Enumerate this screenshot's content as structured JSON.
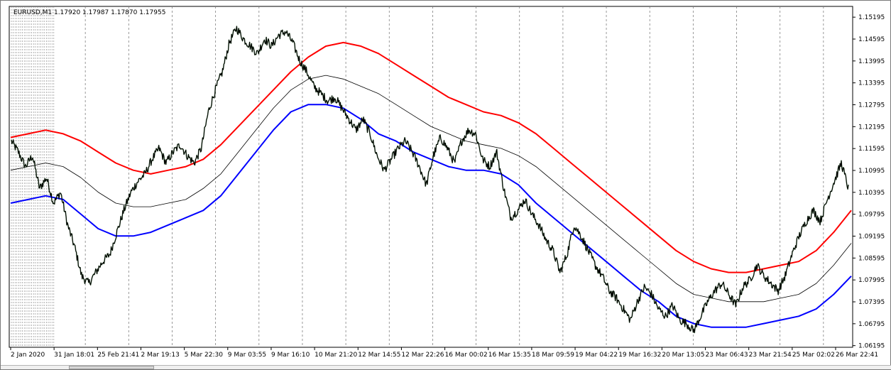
{
  "chart_data": {
    "type": "line",
    "title": "EURUSD,M1 1.17920 1.17987 1.17870 1.17955",
    "symbol": "EURUSD,M1",
    "ohlc": [
      "1.17920",
      "1.17987",
      "1.17870",
      "1.17955"
    ],
    "ylim": [
      1.0615,
      1.1549
    ],
    "y_ticks": [
      "1.15195",
      "1.14595",
      "1.13995",
      "1.13395",
      "1.12795",
      "1.12195",
      "1.11595",
      "1.10995",
      "1.10395",
      "1.09795",
      "1.09195",
      "1.08595",
      "1.07995",
      "1.07395",
      "1.06795",
      "1.06195"
    ],
    "x_ticks": [
      "2 Jan 2020",
      "31 Jan 18:01",
      "25 Feb 21:41",
      "2 Mar 19:13",
      "5 Mar 22:30",
      "9 Mar 03:55",
      "9 Mar 16:10",
      "10 Mar 21:20",
      "12 Mar 14:55",
      "12 Mar 22:26",
      "16 Mar 00:02",
      "16 Mar 15:35",
      "18 Mar 09:59",
      "19 Mar 04:22",
      "19 Mar 16:32",
      "20 Mar 13:05",
      "23 Mar 06:43",
      "23 Mar 21:54",
      "25 Mar 02:02",
      "26 Mar 22:41"
    ],
    "grid": true,
    "legend": "none",
    "series": [
      {
        "color": "#000000",
        "style": "price",
        "values": [
          1.118,
          1.115,
          1.111,
          1.114,
          1.105,
          1.108,
          1.101,
          1.104,
          1.095,
          1.089,
          1.081,
          1.079,
          1.082,
          1.085,
          1.087,
          1.093,
          1.099,
          1.104,
          1.107,
          1.109,
          1.113,
          1.116,
          1.112,
          1.115,
          1.117,
          1.114,
          1.112,
          1.116,
          1.126,
          1.132,
          1.137,
          1.145,
          1.149,
          1.146,
          1.144,
          1.142,
          1.146,
          1.144,
          1.147,
          1.148,
          1.145,
          1.14,
          1.137,
          1.133,
          1.131,
          1.129,
          1.13,
          1.127,
          1.124,
          1.121,
          1.124,
          1.12,
          1.114,
          1.11,
          1.113,
          1.116,
          1.118,
          1.115,
          1.111,
          1.106,
          1.114,
          1.119,
          1.116,
          1.112,
          1.118,
          1.121,
          1.12,
          1.113,
          1.111,
          1.115,
          1.105,
          1.097,
          1.099,
          1.102,
          1.098,
          1.095,
          1.091,
          1.088,
          1.082,
          1.087,
          1.095,
          1.092,
          1.088,
          1.084,
          1.081,
          1.077,
          1.075,
          1.072,
          1.069,
          1.074,
          1.078,
          1.076,
          1.072,
          1.07,
          1.073,
          1.069,
          1.068,
          1.066,
          1.07,
          1.074,
          1.077,
          1.079,
          1.076,
          1.073,
          1.078,
          1.08,
          1.084,
          1.081,
          1.079,
          1.077,
          1.081,
          1.087,
          1.092,
          1.096,
          1.099,
          1.096,
          1.102,
          1.107,
          1.112,
          1.105
        ]
      },
      {
        "color": "#ff0000",
        "style": "band-upper",
        "values": [
          1.119,
          1.12,
          1.121,
          1.12,
          1.118,
          1.115,
          1.112,
          1.11,
          1.109,
          1.11,
          1.111,
          1.113,
          1.117,
          1.122,
          1.127,
          1.132,
          1.137,
          1.141,
          1.144,
          1.145,
          1.144,
          1.142,
          1.139,
          1.136,
          1.133,
          1.13,
          1.128,
          1.126,
          1.125,
          1.123,
          1.12,
          1.116,
          1.112,
          1.108,
          1.104,
          1.1,
          1.096,
          1.092,
          1.088,
          1.085,
          1.083,
          1.082,
          1.082,
          1.083,
          1.084,
          1.085,
          1.088,
          1.093,
          1.099
        ]
      },
      {
        "color": "#000000",
        "style": "band-middle",
        "values": [
          1.11,
          1.111,
          1.112,
          1.111,
          1.108,
          1.104,
          1.101,
          1.1,
          1.1,
          1.101,
          1.102,
          1.105,
          1.109,
          1.115,
          1.121,
          1.127,
          1.132,
          1.135,
          1.136,
          1.135,
          1.133,
          1.131,
          1.128,
          1.125,
          1.122,
          1.12,
          1.118,
          1.117,
          1.116,
          1.114,
          1.111,
          1.107,
          1.103,
          1.099,
          1.095,
          1.091,
          1.087,
          1.083,
          1.079,
          1.076,
          1.075,
          1.074,
          1.074,
          1.074,
          1.075,
          1.076,
          1.079,
          1.084,
          1.09
        ]
      },
      {
        "color": "#0000ff",
        "style": "band-lower",
        "values": [
          1.101,
          1.102,
          1.103,
          1.102,
          1.098,
          1.094,
          1.092,
          1.092,
          1.093,
          1.095,
          1.097,
          1.099,
          1.103,
          1.109,
          1.115,
          1.121,
          1.126,
          1.128,
          1.128,
          1.127,
          1.124,
          1.12,
          1.118,
          1.115,
          1.113,
          1.111,
          1.11,
          1.11,
          1.109,
          1.106,
          1.101,
          1.097,
          1.093,
          1.089,
          1.085,
          1.081,
          1.077,
          1.074,
          1.07,
          1.068,
          1.067,
          1.067,
          1.067,
          1.068,
          1.069,
          1.07,
          1.072,
          1.076,
          1.081
        ]
      }
    ]
  },
  "ui": {
    "grid_color": "#808080",
    "background": "#ffffff",
    "scrollbar": "scrollbar"
  }
}
